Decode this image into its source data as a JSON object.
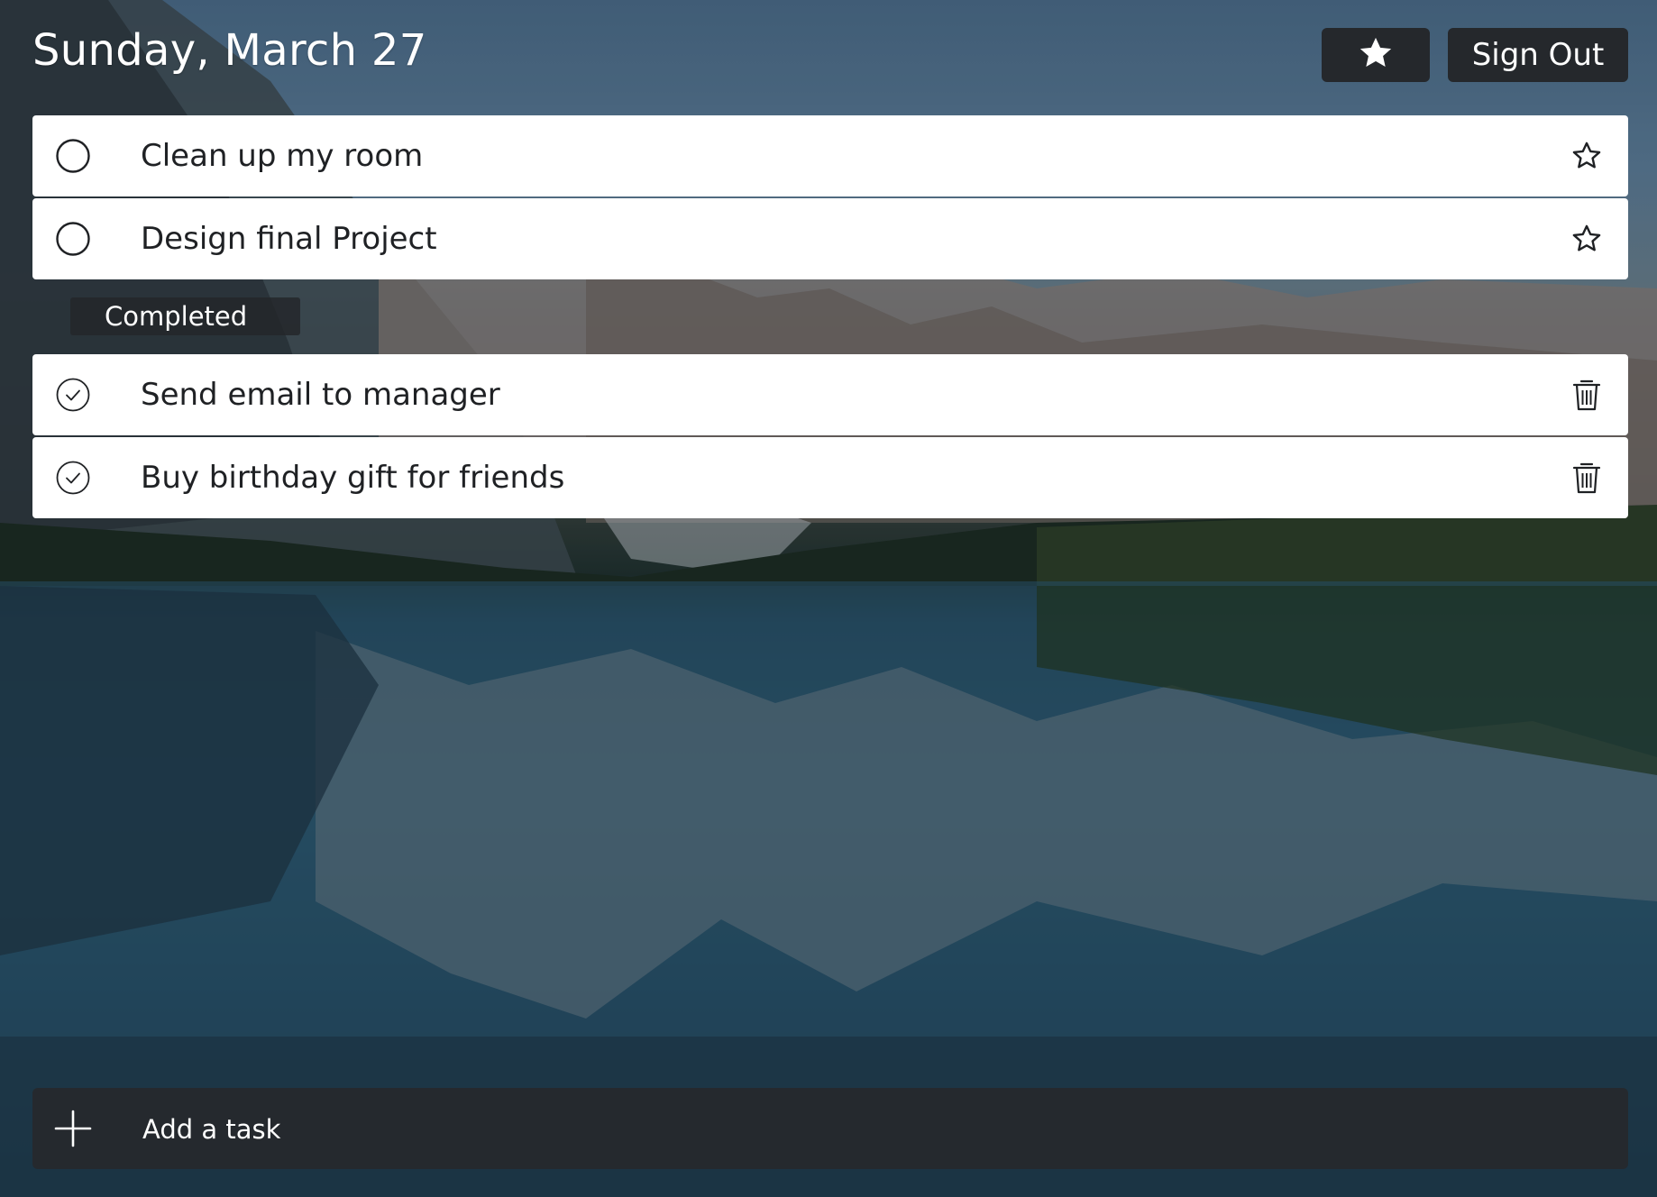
{
  "header": {
    "date": "Sunday, March 27",
    "starred_button_icon": "star-filled-icon",
    "sign_out_label": "Sign Out"
  },
  "tasks": {
    "active": [
      {
        "title": "Clean up my room",
        "status_icon": "circle-icon",
        "action_icon": "star-outline-icon"
      },
      {
        "title": "Design final Project",
        "status_icon": "circle-icon",
        "action_icon": "star-outline-icon"
      }
    ],
    "completed_heading": "Completed",
    "completed": [
      {
        "title": "Send email to manager",
        "status_icon": "check-circle-icon",
        "action_icon": "trash-icon"
      },
      {
        "title": "Buy birthday gift for friends",
        "status_icon": "check-circle-icon",
        "action_icon": "trash-icon"
      }
    ]
  },
  "add_task": {
    "placeholder": "Add a task",
    "icon": "plus-icon"
  },
  "colors": {
    "button_dark": "#25282c",
    "task_background": "#ffffff",
    "text_dark": "#1f2124"
  }
}
